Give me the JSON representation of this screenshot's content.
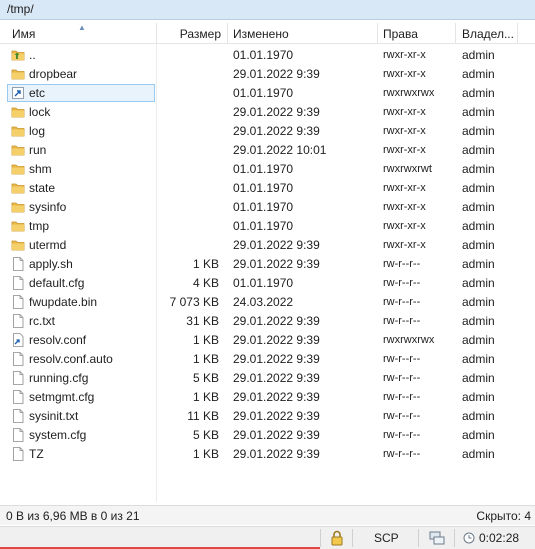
{
  "path": "/tmp/",
  "columns": {
    "name": "Имя",
    "size": "Размер",
    "modified": "Изменено",
    "rights": "Права",
    "owner": "Владел..."
  },
  "files": [
    {
      "name": "..",
      "size": "",
      "modified": "01.01.1970",
      "rights": "rwxr-xr-x",
      "owner": "admin",
      "icon": "parent-folder-icon",
      "kind": "parent"
    },
    {
      "name": "dropbear",
      "size": "",
      "modified": "29.01.2022 9:39",
      "rights": "rwxr-xr-x",
      "owner": "admin",
      "icon": "folder-icon",
      "kind": "folder"
    },
    {
      "name": "etc",
      "size": "",
      "modified": "01.01.1970",
      "rights": "rwxrwxrwx",
      "owner": "admin",
      "icon": "folder-link-icon",
      "kind": "link"
    },
    {
      "name": "lock",
      "size": "",
      "modified": "29.01.2022 9:39",
      "rights": "rwxr-xr-x",
      "owner": "admin",
      "icon": "folder-icon",
      "kind": "folder"
    },
    {
      "name": "log",
      "size": "",
      "modified": "29.01.2022 9:39",
      "rights": "rwxr-xr-x",
      "owner": "admin",
      "icon": "folder-icon",
      "kind": "folder"
    },
    {
      "name": "run",
      "size": "",
      "modified": "29.01.2022 10:01",
      "rights": "rwxr-xr-x",
      "owner": "admin",
      "icon": "folder-icon",
      "kind": "folder"
    },
    {
      "name": "shm",
      "size": "",
      "modified": "01.01.1970",
      "rights": "rwxrwxrwt",
      "owner": "admin",
      "icon": "folder-icon",
      "kind": "folder"
    },
    {
      "name": "state",
      "size": "",
      "modified": "01.01.1970",
      "rights": "rwxr-xr-x",
      "owner": "admin",
      "icon": "folder-icon",
      "kind": "folder"
    },
    {
      "name": "sysinfo",
      "size": "",
      "modified": "01.01.1970",
      "rights": "rwxr-xr-x",
      "owner": "admin",
      "icon": "folder-icon",
      "kind": "folder"
    },
    {
      "name": "tmp",
      "size": "",
      "modified": "01.01.1970",
      "rights": "rwxr-xr-x",
      "owner": "admin",
      "icon": "folder-icon",
      "kind": "folder"
    },
    {
      "name": "utermd",
      "size": "",
      "modified": "29.01.2022 9:39",
      "rights": "rwxr-xr-x",
      "owner": "admin",
      "icon": "folder-icon",
      "kind": "folder"
    },
    {
      "name": "apply.sh",
      "size": "1 KB",
      "modified": "29.01.2022 9:39",
      "rights": "rw-r--r--",
      "owner": "admin",
      "icon": "file-icon",
      "kind": "file"
    },
    {
      "name": "default.cfg",
      "size": "4 KB",
      "modified": "01.01.1970",
      "rights": "rw-r--r--",
      "owner": "admin",
      "icon": "file-icon",
      "kind": "file"
    },
    {
      "name": "fwupdate.bin",
      "size": "7 073 KB",
      "modified": "24.03.2022",
      "rights": "rw-r--r--",
      "owner": "admin",
      "icon": "file-icon",
      "kind": "file"
    },
    {
      "name": "rc.txt",
      "size": "31 KB",
      "modified": "29.01.2022 9:39",
      "rights": "rw-r--r--",
      "owner": "admin",
      "icon": "file-icon",
      "kind": "file"
    },
    {
      "name": "resolv.conf",
      "size": "1 KB",
      "modified": "29.01.2022 9:39",
      "rights": "rwxrwxrwx",
      "owner": "admin",
      "icon": "file-link-icon",
      "kind": "filelink"
    },
    {
      "name": "resolv.conf.auto",
      "size": "1 KB",
      "modified": "29.01.2022 9:39",
      "rights": "rw-r--r--",
      "owner": "admin",
      "icon": "file-icon",
      "kind": "file"
    },
    {
      "name": "running.cfg",
      "size": "5 KB",
      "modified": "29.01.2022 9:39",
      "rights": "rw-r--r--",
      "owner": "admin",
      "icon": "file-icon",
      "kind": "file"
    },
    {
      "name": "setmgmt.cfg",
      "size": "1 KB",
      "modified": "29.01.2022 9:39",
      "rights": "rw-r--r--",
      "owner": "admin",
      "icon": "file-icon",
      "kind": "file"
    },
    {
      "name": "sysinit.txt",
      "size": "11 KB",
      "modified": "29.01.2022 9:39",
      "rights": "rw-r--r--",
      "owner": "admin",
      "icon": "file-icon",
      "kind": "file"
    },
    {
      "name": "system.cfg",
      "size": "5 KB",
      "modified": "29.01.2022 9:39",
      "rights": "rw-r--r--",
      "owner": "admin",
      "icon": "file-icon",
      "kind": "file"
    },
    {
      "name": "TZ",
      "size": "1 KB",
      "modified": "29.01.2022 9:39",
      "rights": "rw-r--r--",
      "owner": "admin",
      "icon": "file-icon",
      "kind": "file"
    }
  ],
  "selected_index": 2,
  "status": {
    "selection": "0 B из 6,96 MB в 0 из 21",
    "hidden": "Скрыто: 4"
  },
  "bottom": {
    "lock_icon": "lock-icon",
    "protocol": "SCP",
    "network_icon": "network-icon",
    "elapsed": "0:02:28"
  },
  "colors": {
    "folder": "#e8b84a",
    "pathbar": "#d9e8f7",
    "selection": "#e8f3fc",
    "accent": "#e04848"
  }
}
